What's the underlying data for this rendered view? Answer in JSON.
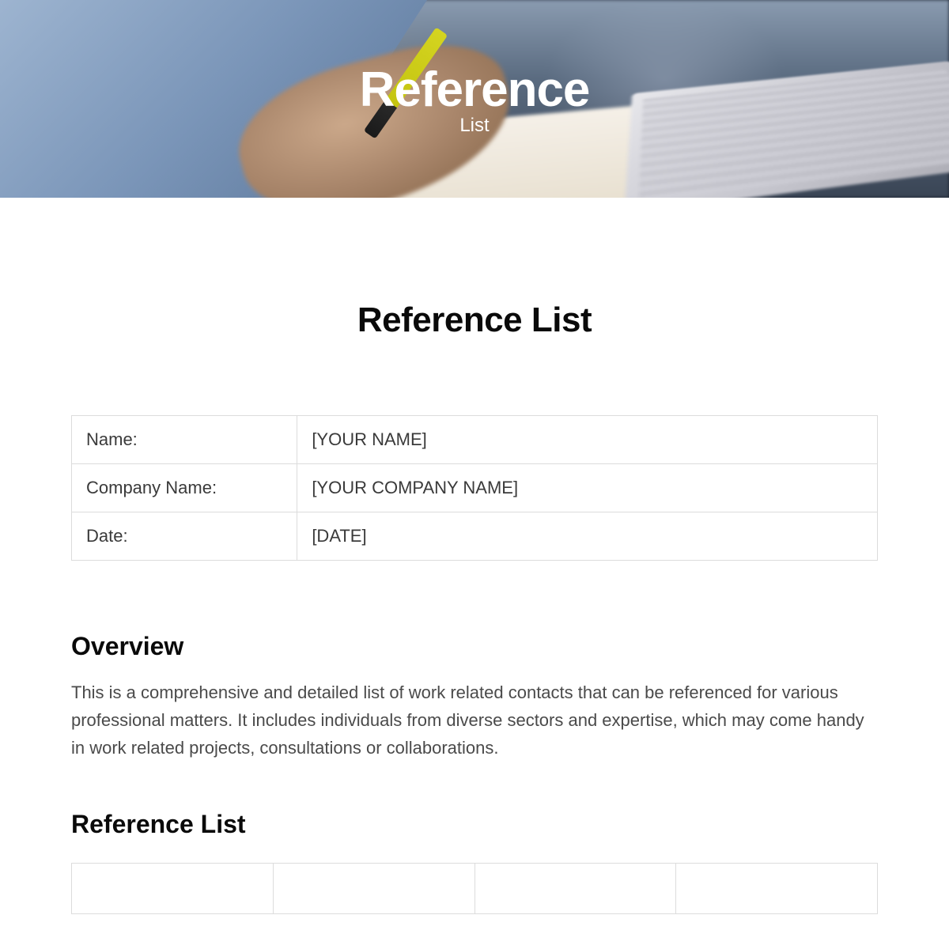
{
  "hero": {
    "title": "Reference",
    "subtitle": "List"
  },
  "main_title": "Reference List",
  "info_table": {
    "rows": [
      {
        "label": "Name:",
        "value": "[YOUR NAME]"
      },
      {
        "label": "Company Name:",
        "value": "[YOUR COMPANY NAME]"
      },
      {
        "label": "Date:",
        "value": "[DATE]"
      }
    ]
  },
  "overview": {
    "heading": "Overview",
    "text": "This is a comprehensive and detailed list of work related contacts that can be referenced for various professional matters. It includes individuals from diverse sectors and expertise, which may come handy in work related projects, consultations or collaborations."
  },
  "reference_list": {
    "heading": "Reference List"
  }
}
